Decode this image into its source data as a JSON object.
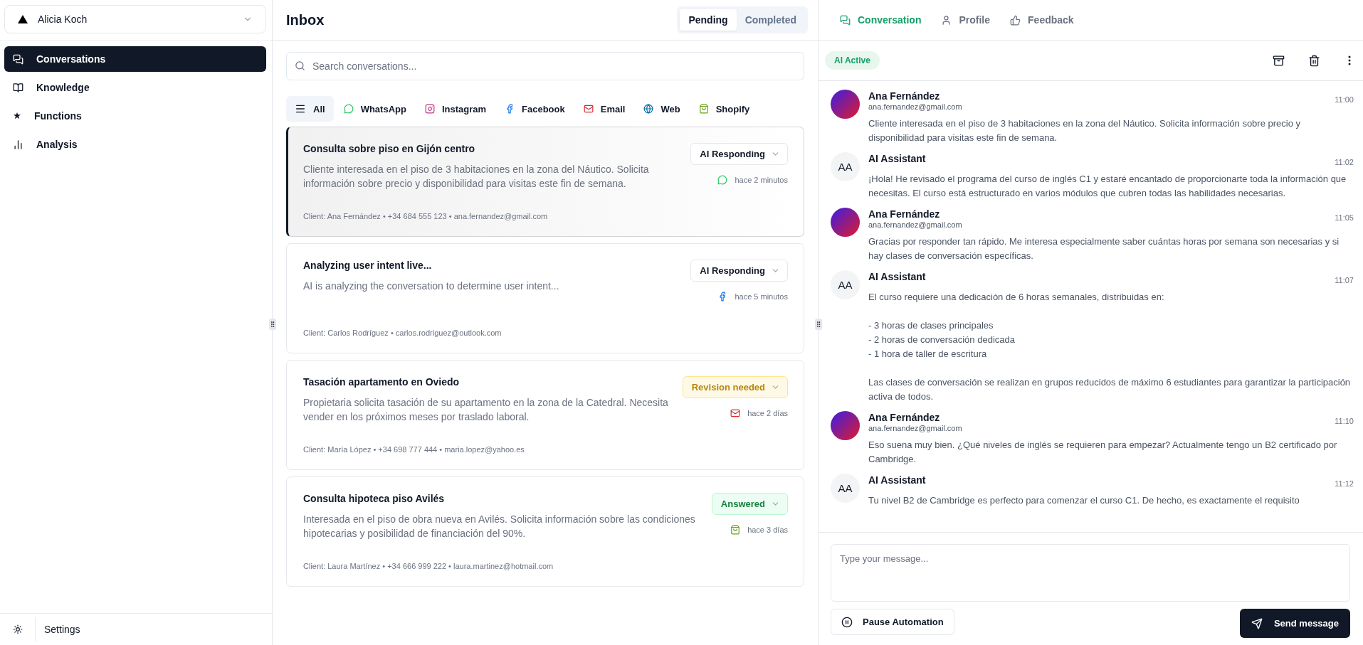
{
  "sidebar": {
    "account": {
      "name": "Alicia Koch"
    },
    "nav": [
      {
        "label": "Conversations",
        "selected": true
      },
      {
        "label": "Knowledge",
        "selected": false
      },
      {
        "label": "Functions",
        "selected": false
      },
      {
        "label": "Analysis",
        "selected": false
      }
    ],
    "settings": {
      "label": "Settings"
    }
  },
  "inbox": {
    "title": "Inbox",
    "tabs": [
      {
        "label": "Pending",
        "selected": true
      },
      {
        "label": "Completed",
        "selected": false
      }
    ],
    "search": {
      "placeholder": "Search conversations..."
    },
    "filters": [
      {
        "label": "All",
        "kind": "all",
        "selected": true
      },
      {
        "label": "WhatsApp",
        "kind": "whatsapp",
        "selected": false
      },
      {
        "label": "Instagram",
        "kind": "instagram",
        "selected": false
      },
      {
        "label": "Facebook",
        "kind": "facebook",
        "selected": false
      },
      {
        "label": "Email",
        "kind": "email",
        "selected": false
      },
      {
        "label": "Web",
        "kind": "web",
        "selected": false
      },
      {
        "label": "Shopify",
        "kind": "shopify",
        "selected": false
      }
    ],
    "conversations": [
      {
        "title": "Consulta sobre piso en Gijón centro",
        "summary": "Cliente interesada en el piso de 3 habitaciones en la zona del Náutico. Solicita información sobre precio y disponibilidad para visitas este fin de semana.",
        "status": {
          "label": "AI Responding",
          "kind": "responding"
        },
        "kind": "whatsapp",
        "time": "hace 2 minutos",
        "client": "Client: Ana Fernández • +34 684 555 123 • ana.fernandez@gmail.com",
        "selected": true
      },
      {
        "title": "Analyzing user intent live...",
        "summary": "AI is analyzing the conversation to determine user intent...",
        "status": {
          "label": "AI Responding",
          "kind": "responding"
        },
        "kind": "facebook",
        "time": "hace 5 minutos",
        "client": "Client: Carlos Rodríguez • carlos.rodriguez@outlook.com",
        "selected": false
      },
      {
        "title": "Tasación apartamento en Oviedo",
        "summary": "Propietaria solicita tasación de su apartamento en la zona de la Catedral. Necesita vender en los próximos meses por traslado laboral.",
        "status": {
          "label": "Revision needed",
          "kind": "revision"
        },
        "kind": "email",
        "time": "hace 2 días",
        "client": "Client: María López • +34 698 777 444 • maria.lopez@yahoo.es",
        "selected": false
      },
      {
        "title": "Consulta hipoteca piso Avilés",
        "summary": "Interesada en el piso de obra nueva en Avilés. Solicita información sobre las condiciones hipotecarias y posibilidad de financiación del 90%.",
        "status": {
          "label": "Answered",
          "kind": "answered"
        },
        "kind": "shopify",
        "time": "hace 3 días",
        "client": "Client: Laura Martínez • +34 666 999 222 • laura.martinez@hotmail.com",
        "selected": false
      }
    ]
  },
  "detail": {
    "tabs": [
      {
        "label": "Conversation",
        "selected": true
      },
      {
        "label": "Profile",
        "selected": false
      },
      {
        "label": "Feedback",
        "selected": false
      }
    ],
    "badge": "AI Active",
    "messages": [
      {
        "kind": "customer",
        "name": "Ana Fernández",
        "email": "ana.fernandez@gmail.com",
        "time": "11:00",
        "text": "Cliente interesada en el piso de 3 habitaciones en la zona del Náutico. Solicita información sobre precio y disponibilidad para visitas este fin de semana."
      },
      {
        "kind": "assistant",
        "name": "AI Assistant",
        "initials": "AA",
        "time": "11:02",
        "text": "¡Hola! He revisado el programa del curso de inglés C1 y estaré encantado de proporcionarte toda la información que necesitas. El curso está estructurado en varios módulos que cubren todas las habilidades necesarias."
      },
      {
        "kind": "customer",
        "name": "Ana Fernández",
        "email": "ana.fernandez@gmail.com",
        "time": "11:05",
        "text": "Gracias por responder tan rápido. Me interesa especialmente saber cuántas horas por semana son necesarias y si hay clases de conversación específicas."
      },
      {
        "kind": "assistant",
        "name": "AI Assistant",
        "initials": "AA",
        "time": "11:07",
        "text": "El curso requiere una dedicación de 6 horas semanales, distribuidas en:\n\n- 3 horas de clases principales\n- 2 horas de conversación dedicada\n- 1 hora de taller de escritura\n\nLas clases de conversación se realizan en grupos reducidos de máximo 6 estudiantes para garantizar la participación activa de todos."
      },
      {
        "kind": "customer",
        "name": "Ana Fernández",
        "email": "ana.fernandez@gmail.com",
        "time": "11:10",
        "text": "Eso suena muy bien. ¿Qué niveles de inglés se requieren para empezar? Actualmente tengo un B2 certificado por Cambridge."
      },
      {
        "kind": "assistant",
        "name": "AI Assistant",
        "initials": "AA",
        "time": "11:12",
        "text": "Tu nivel B2 de Cambridge es perfecto para comenzar el curso C1. De hecho, es exactamente el requisito"
      }
    ],
    "composer": {
      "placeholder": "Type your message..."
    },
    "pause_button": "Pause Automation",
    "send_button": "Send message"
  }
}
